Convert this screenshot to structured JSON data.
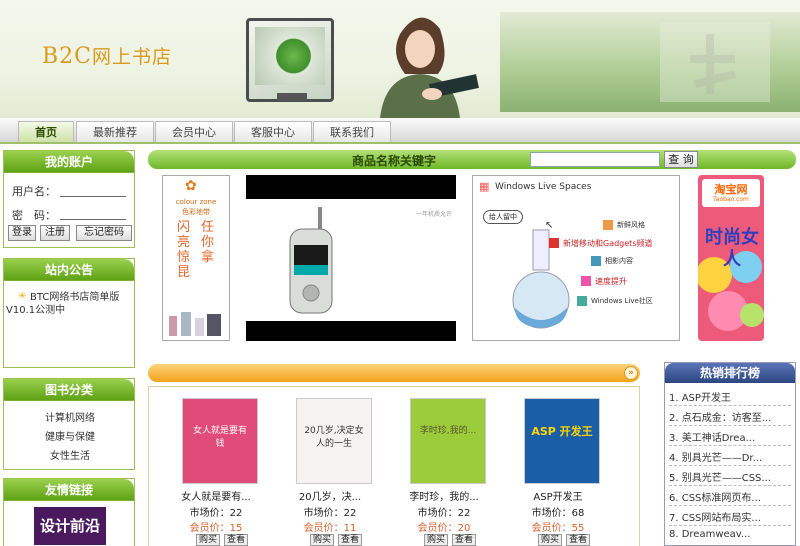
{
  "header": {
    "logo_en": "B2C",
    "logo_cn": "网上书店"
  },
  "nav": {
    "tabs": [
      "首页",
      "最新推荐",
      "会员中心",
      "客服中心",
      "联系我们"
    ]
  },
  "account": {
    "title": "我的账户",
    "username_label": "用户名：",
    "password_label": "密　码：",
    "login": "登录",
    "register": "注册",
    "forgot": "忘记密码"
  },
  "notice": {
    "title": "站内公告",
    "items": [
      "BTC网络书店简单版V10.1公测中"
    ]
  },
  "categories": {
    "title": "图书分类",
    "items": [
      "计算机网络",
      "健康与保健",
      "女性生活"
    ]
  },
  "links": {
    "title": "友情链接",
    "logo_text": "设计前沿"
  },
  "search": {
    "label": "商品名称关键字",
    "button": "查 询",
    "placeholder": ""
  },
  "ads": {
    "ad1_brand_en": "colour zone",
    "ad1_brand_cn": "色彩地带",
    "ad1_slogan_left": "闪亮惊昆",
    "ad1_slogan_right": "任你拿",
    "ad2_caption": "一年机质允许",
    "ad3_title": "Windows Live Spaces",
    "ad3_bubble": "给人留中",
    "ad3_items": [
      "新鲜风格",
      "新增移动和Gadgets频道",
      "相影内容",
      "速度提升",
      "Windows Live社区"
    ],
    "ad4_brand": "淘宝网",
    "ad4_brand_en": "Taobao.com",
    "ad4_slogan": "时尚女人"
  },
  "products": {
    "market_label": "市场价：",
    "member_label": "会员价：",
    "buy": "购买",
    "view": "查看",
    "items": [
      {
        "name": "女人就是要有...",
        "market": "22",
        "member": "15",
        "cover_text": "女人就是要有钱",
        "color": "#e14b7a"
      },
      {
        "name": "20几岁，决...",
        "market": "22",
        "member": "11",
        "cover_text": "20几岁,决定女人的一生",
        "color": "#f7f2f2"
      },
      {
        "name": "李时珍，我的...",
        "market": "22",
        "member": "20",
        "cover_text": "李时珍,我的...",
        "color": "#9dcc3a"
      },
      {
        "name": "ASP开发王",
        "market": "68",
        "member": "55",
        "cover_text": "ASP 开发王",
        "color": "#1b5ea8"
      }
    ]
  },
  "ranking": {
    "title": "热销排行榜",
    "items": [
      "1. ASP开发王",
      "2. 点石成金：访客至...",
      "3. 美工神话Drea...",
      "4. 别具光芒——Dr...",
      "5. 别具光芒——CSS...",
      "6. CSS标准网页布...",
      "7. CSS网站布局实...",
      "8. Dreamweav..."
    ]
  },
  "colors": {
    "green": "#6eb828",
    "orange": "#f2a21a",
    "blue": "#2c4680",
    "logo": "#d99a1e"
  }
}
